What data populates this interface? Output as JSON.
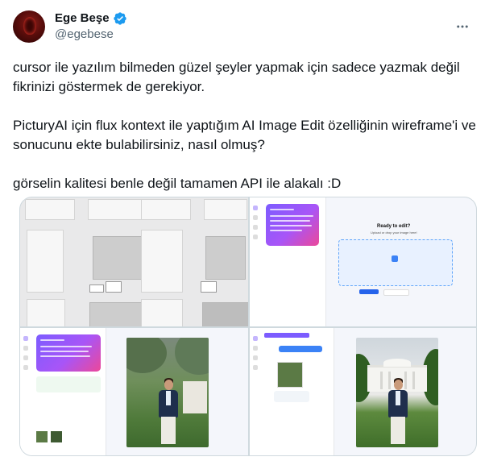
{
  "author": {
    "display_name": "Ege Beşe",
    "handle": "@egebese",
    "verified": true,
    "verified_color": "#1d9bf0"
  },
  "more_icon": "more-horizontal-icon",
  "tweet": {
    "paragraphs": [
      "cursor ile yazılım bilmeden güzel şeyler yapmak için sadece yazmak değil fikrinizi göstermek de gerekiyor.",
      "PicturyAI için flux kontext ile yaptığım AI Image Edit özelliğinin wireframe'i ve sonucunu ekte bulabilirsiniz, nasıl olmuş?",
      "görselin kalitesi benle değil tamamen API ile alakalı :D"
    ]
  },
  "media": {
    "count": 4,
    "app_screen": {
      "title": "Ready to edit?",
      "subtitle": "Upload or drop your image here!"
    }
  }
}
